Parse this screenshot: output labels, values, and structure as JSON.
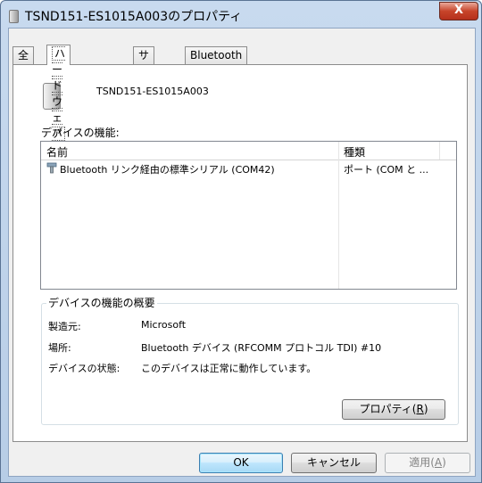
{
  "window": {
    "title": "TSND151-ES1015A003のプロパティ",
    "close_label": "X"
  },
  "tabs": [
    "全般",
    "ハードウェア",
    "サービス",
    "Bluetooth"
  ],
  "device": {
    "name": "TSND151-ES1015A003"
  },
  "functions": {
    "section_label": "デバイスの機能:",
    "columns": [
      "名前",
      "種類"
    ],
    "rows": [
      {
        "name": "Bluetooth リンク経由の標準シリアル (COM42)",
        "type": "ポート (COM と ..."
      }
    ]
  },
  "summary": {
    "group_label": "デバイスの機能の概要",
    "manufacturer_label": "製造元:",
    "manufacturer_value": "Microsoft",
    "location_label": "場所:",
    "location_value": "Bluetooth デバイス (RFCOMM プロトコル TDI) #10",
    "status_label": "デバイスの状態:",
    "status_value": "このデバイスは正常に動作しています。",
    "properties_button": "プロパティ(",
    "properties_accel": "R",
    "properties_close": ")"
  },
  "buttons": {
    "ok": "OK",
    "cancel": "キャンセル",
    "apply": "適用(",
    "apply_accel": "A",
    "apply_close": ")"
  }
}
